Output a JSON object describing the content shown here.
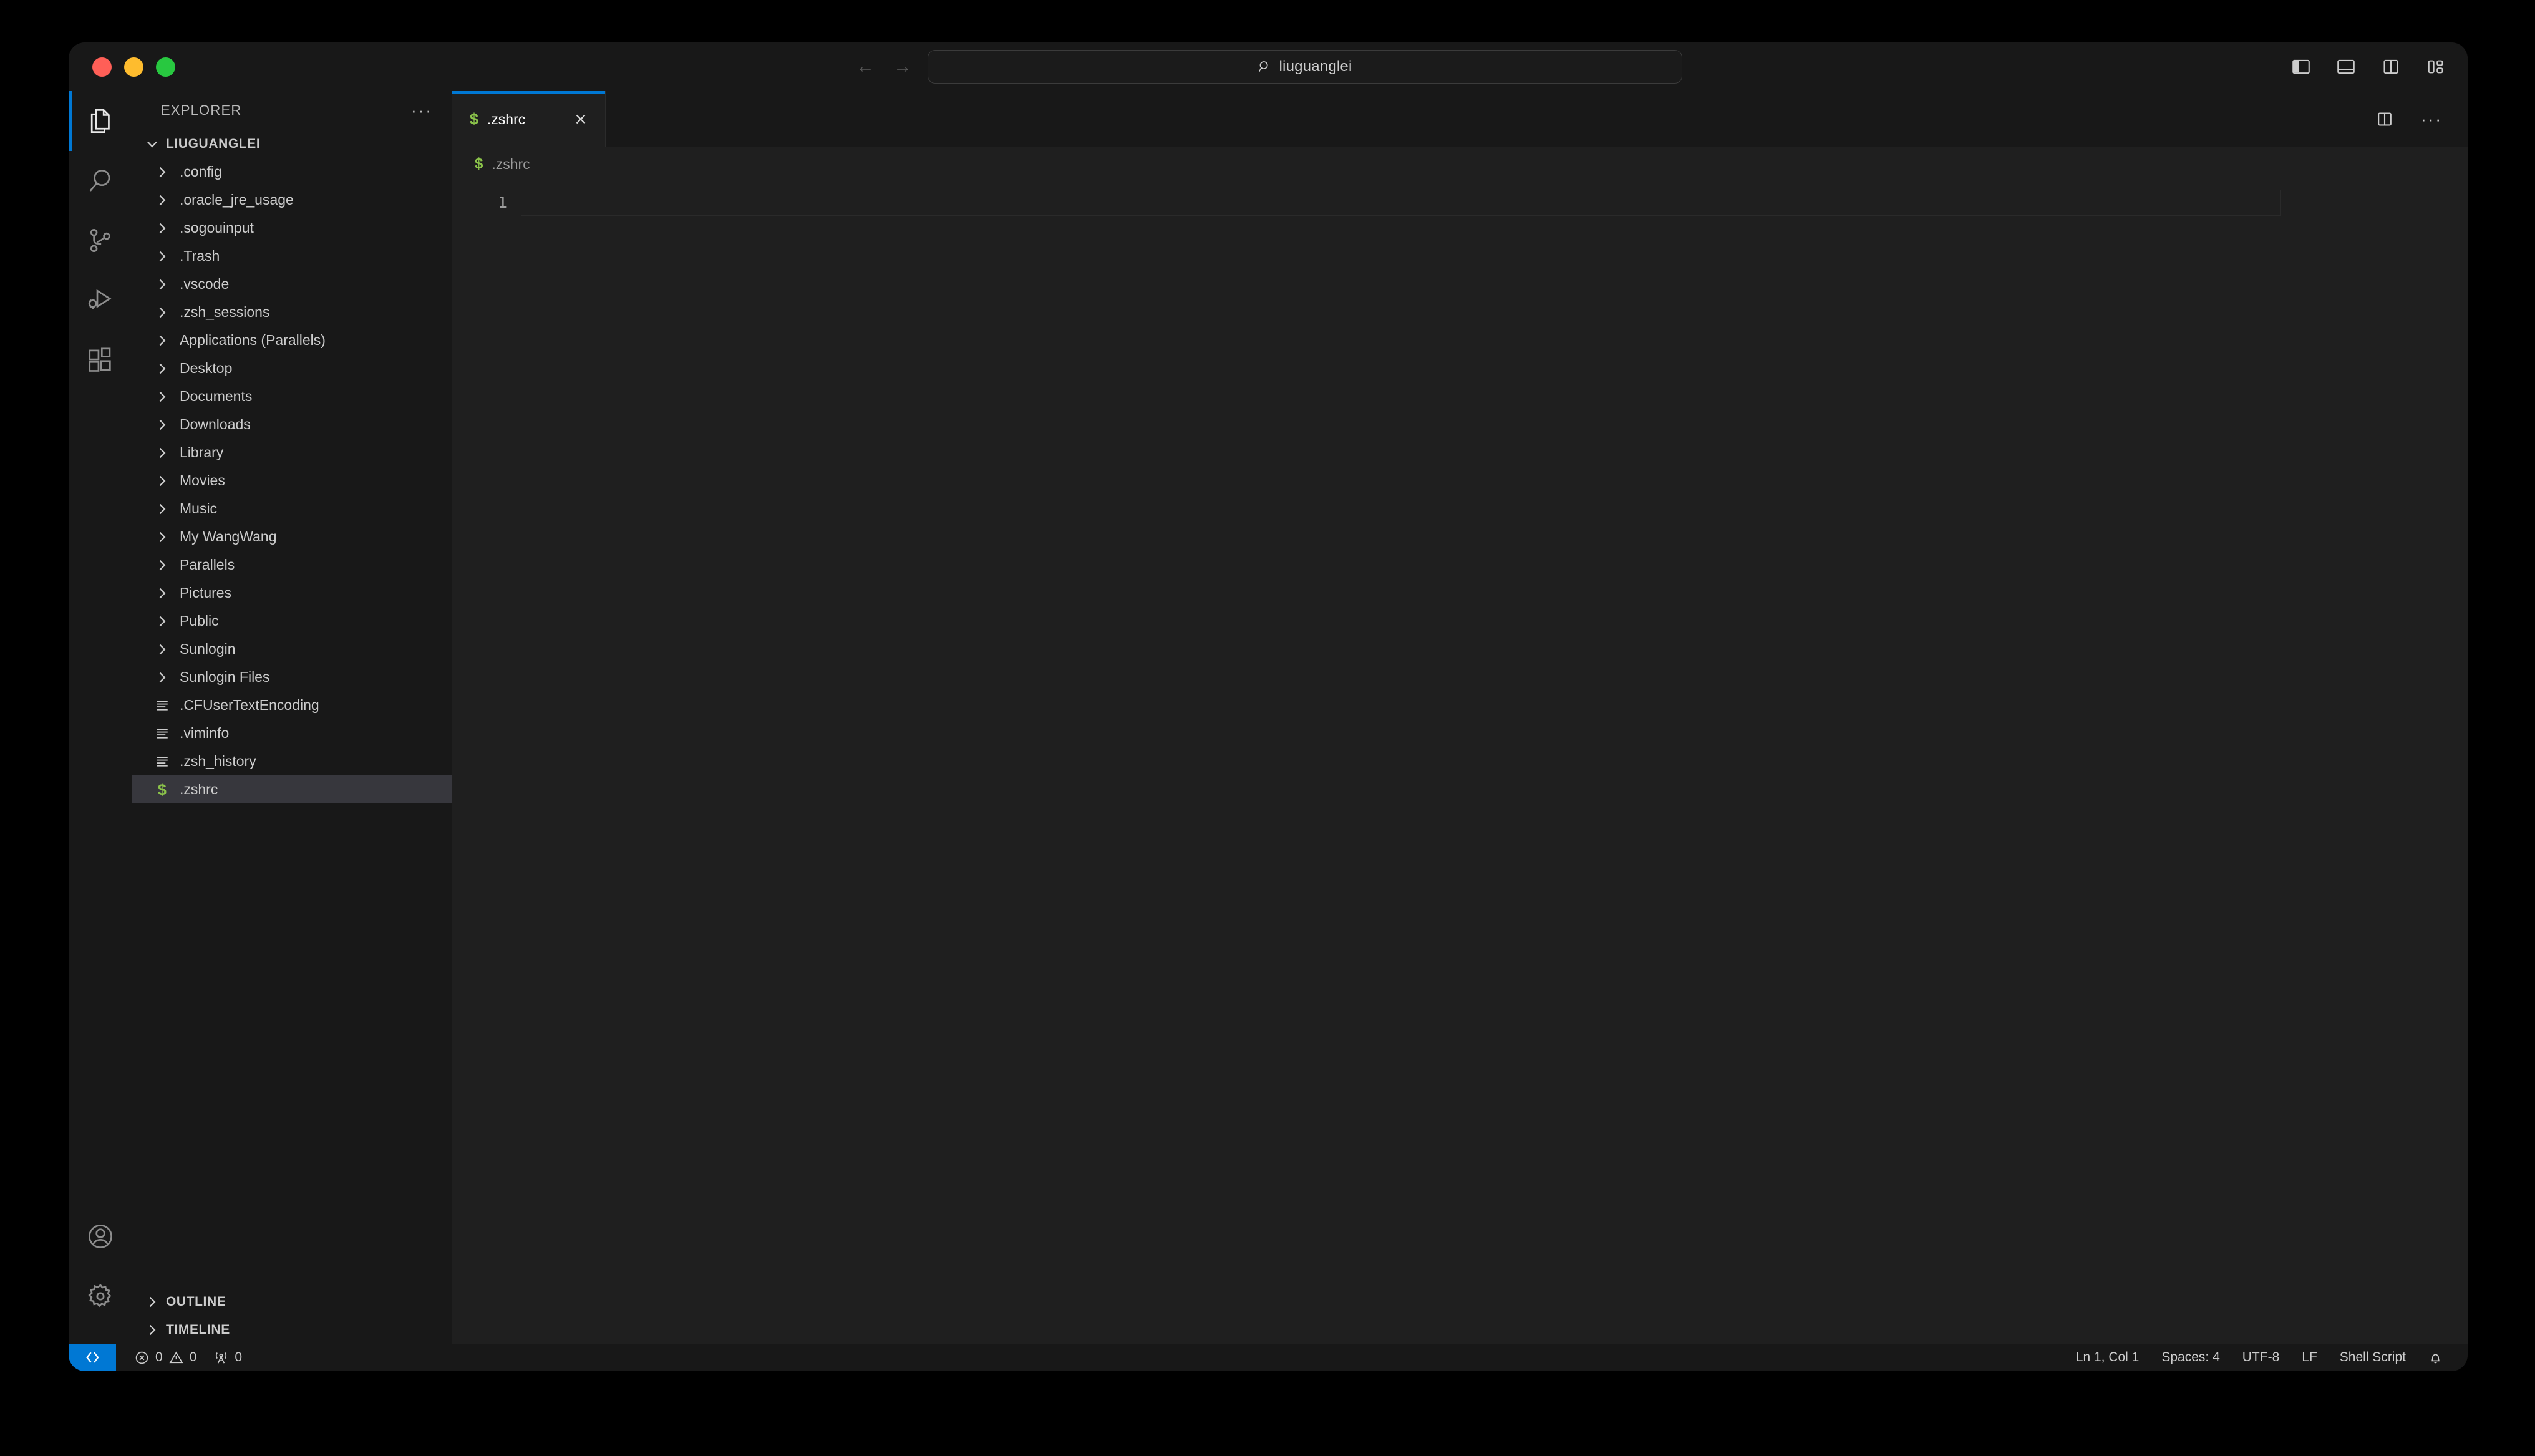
{
  "window": {
    "traffic_lights": [
      "close",
      "minimize",
      "maximize"
    ],
    "colors": {
      "accent": "#0078d4",
      "tab_active_border": "#0078d4",
      "shell_icon_green": "#8bc34a",
      "selection_bg": "#37373d",
      "editor_bg": "#1f1f1f",
      "chrome_bg": "#181818",
      "traffic_red": "#FF5F57",
      "traffic_yellow": "#FEBC2E",
      "traffic_green": "#28C840"
    }
  },
  "titlebar": {
    "back_arrow": "←",
    "forward_arrow": "→",
    "command_center": {
      "icon": "search-icon",
      "text": "liuguanglei"
    },
    "layout_buttons": [
      {
        "name": "toggle-primary-sidebar",
        "label": "Toggle Primary Side Bar"
      },
      {
        "name": "toggle-panel",
        "label": "Toggle Panel"
      },
      {
        "name": "toggle-secondary-sidebar",
        "label": "Toggle Secondary Side Bar"
      },
      {
        "name": "customize-layout",
        "label": "Customize Layout"
      }
    ]
  },
  "activitybar": {
    "top_items": [
      {
        "name": "explorer",
        "icon": "files-icon",
        "active": true
      },
      {
        "name": "search",
        "icon": "search-icon",
        "active": false
      },
      {
        "name": "source-control",
        "icon": "source-control-icon",
        "active": false
      },
      {
        "name": "run-and-debug",
        "icon": "debug-icon",
        "active": false
      },
      {
        "name": "extensions",
        "icon": "extensions-icon",
        "active": false
      }
    ],
    "bottom_items": [
      {
        "name": "accounts",
        "icon": "account-icon"
      },
      {
        "name": "settings",
        "icon": "gear-icon"
      }
    ]
  },
  "sidebar": {
    "title": "EXPLORER",
    "more_actions": "···",
    "root_folder": "LIUGUANGLEI",
    "tree": [
      {
        "label": ".config",
        "type": "folder"
      },
      {
        "label": ".oracle_jre_usage",
        "type": "folder"
      },
      {
        "label": ".sogouinput",
        "type": "folder"
      },
      {
        "label": ".Trash",
        "type": "folder"
      },
      {
        "label": ".vscode",
        "type": "folder"
      },
      {
        "label": ".zsh_sessions",
        "type": "folder"
      },
      {
        "label": "Applications (Parallels)",
        "type": "folder"
      },
      {
        "label": "Desktop",
        "type": "folder"
      },
      {
        "label": "Documents",
        "type": "folder"
      },
      {
        "label": "Downloads",
        "type": "folder"
      },
      {
        "label": "Library",
        "type": "folder"
      },
      {
        "label": "Movies",
        "type": "folder"
      },
      {
        "label": "Music",
        "type": "folder"
      },
      {
        "label": "My WangWang",
        "type": "folder"
      },
      {
        "label": "Parallels",
        "type": "folder"
      },
      {
        "label": "Pictures",
        "type": "folder"
      },
      {
        "label": "Public",
        "type": "folder"
      },
      {
        "label": "Sunlogin",
        "type": "folder"
      },
      {
        "label": "Sunlogin Files",
        "type": "folder"
      },
      {
        "label": ".CFUserTextEncoding",
        "type": "file"
      },
      {
        "label": ".viminfo",
        "type": "file"
      },
      {
        "label": ".zsh_history",
        "type": "file"
      },
      {
        "label": ".zshrc",
        "type": "shell",
        "selected": true
      }
    ],
    "bottom_panels": [
      {
        "label": "OUTLINE",
        "expanded": false
      },
      {
        "label": "TIMELINE",
        "expanded": false
      }
    ]
  },
  "editor": {
    "tabs": [
      {
        "label": ".zshrc",
        "icon": "shell-script-icon",
        "active": true,
        "close": "×"
      }
    ],
    "actions": {
      "split_editor": "split-editor-icon",
      "more": "···"
    },
    "breadcrumb": {
      "icon": "shell-script-icon",
      "label": ".zshrc"
    },
    "line_numbers": [
      "1"
    ],
    "content": [
      ""
    ]
  },
  "statusbar": {
    "remote_icon": "remote-window-icon",
    "problems": {
      "error_icon": "error-icon",
      "error_count": "0",
      "warning_icon": "warning-icon",
      "warning_count": "0"
    },
    "ports": {
      "icon": "radio-tower-icon",
      "count": "0"
    },
    "right_items": [
      {
        "name": "editor-position",
        "label": "Ln 1, Col 1"
      },
      {
        "name": "editor-indentation",
        "label": "Spaces: 4"
      },
      {
        "name": "editor-encoding",
        "label": "UTF-8"
      },
      {
        "name": "editor-eol",
        "label": "LF"
      },
      {
        "name": "editor-language",
        "label": "Shell Script"
      }
    ],
    "notifications_icon": "bell-icon"
  }
}
